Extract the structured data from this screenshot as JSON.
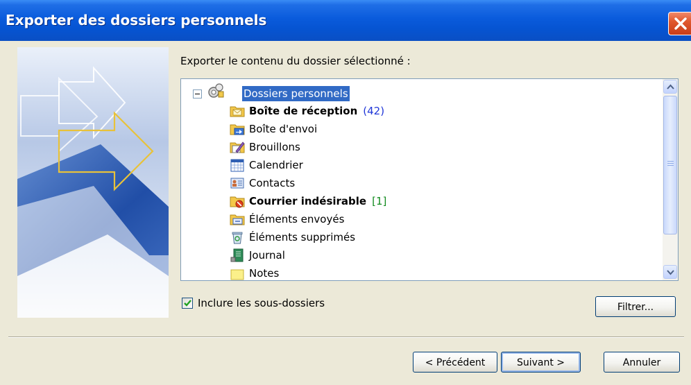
{
  "window": {
    "title": "Exporter des dossiers personnels"
  },
  "main": {
    "prompt": "Exporter le contenu du dossier sélectionné :",
    "tree": {
      "root": "Dossiers personnels",
      "items": [
        {
          "label": "Boîte de réception",
          "count": "(42)",
          "bold": true,
          "icon": "inbox-folder-icon"
        },
        {
          "label": "Boîte d'envoi",
          "icon": "outbox-folder-icon"
        },
        {
          "label": "Brouillons",
          "icon": "drafts-folder-icon"
        },
        {
          "label": "Calendrier",
          "icon": "calendar-folder-icon"
        },
        {
          "label": "Contacts",
          "icon": "contacts-folder-icon"
        },
        {
          "label": "Courrier indésirable",
          "count": "[1]",
          "bold": true,
          "icon": "junk-mail-folder-icon"
        },
        {
          "label": "Éléments envoyés",
          "icon": "sent-items-folder-icon"
        },
        {
          "label": "Éléments supprimés",
          "icon": "deleted-items-folder-icon"
        },
        {
          "label": "Journal",
          "icon": "journal-folder-icon"
        },
        {
          "label": "Notes",
          "icon": "notes-folder-icon"
        }
      ]
    },
    "include_subfolders": {
      "label": "Inclure les sous-dossiers",
      "checked": true
    },
    "filter_button": "Filtrer..."
  },
  "footer": {
    "back": "< Précédent",
    "next": "Suivant >",
    "cancel": "Annuler"
  },
  "colors": {
    "titlebar": "#0a5bdc",
    "selection": "#316ac5",
    "unread_count": "#1f36d8",
    "junk_count": "#118a1e"
  }
}
